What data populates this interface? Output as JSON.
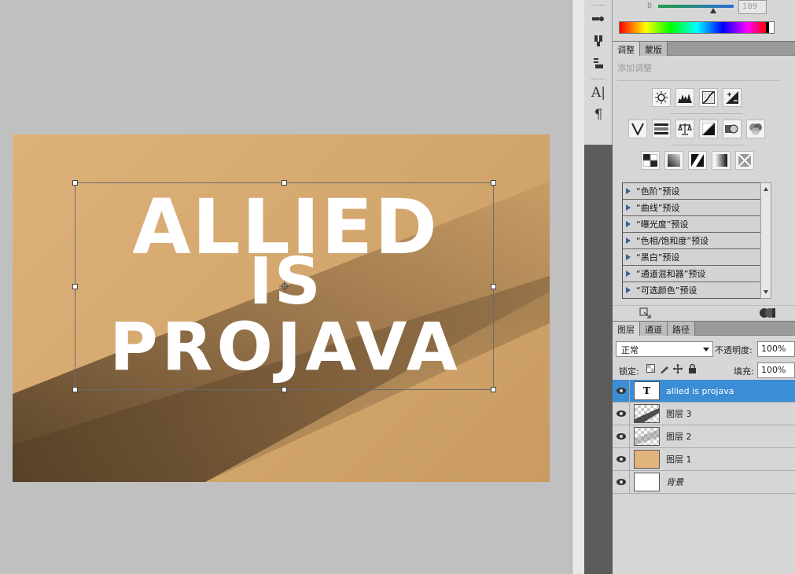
{
  "canvas": {
    "line1": "ALLIED",
    "line2": "IS",
    "line3": "PROJAVA"
  },
  "color_panel": {
    "channel_label": "B",
    "channel_value": "189"
  },
  "adjustments": {
    "tabs": [
      {
        "label": "调整",
        "active": true
      },
      {
        "label": "蒙版",
        "active": false
      }
    ],
    "add_label": "添加调整",
    "presets": [
      {
        "label": "“色阶”预设"
      },
      {
        "label": "“曲线”预设"
      },
      {
        "label": "“曝光度”预设"
      },
      {
        "label": "“色相/饱和度”预设"
      },
      {
        "label": "“黑白”预设"
      },
      {
        "label": "“通道混和器”预设"
      },
      {
        "label": "“可选颜色”预设"
      }
    ]
  },
  "layers": {
    "tabs": [
      {
        "label": "图层",
        "active": true
      },
      {
        "label": "通道",
        "active": false
      },
      {
        "label": "路径",
        "active": false
      }
    ],
    "blend_mode": "正常",
    "opacity_label": "不透明度:",
    "opacity_value": "100%",
    "lock_label": "锁定:",
    "fill_label": "填充:",
    "fill_value": "100%",
    "items": [
      {
        "name": "allied is projava",
        "thumb": "T",
        "selected": true
      },
      {
        "name": "图层 3",
        "selected": false
      },
      {
        "name": "图层 2",
        "selected": false
      },
      {
        "name": "图层 1",
        "selected": false
      },
      {
        "name": "背景",
        "selected": false
      }
    ]
  },
  "colors": {
    "canvas_background": "#d5a970",
    "selection_highlight": "#3b8ed5",
    "panel_background": "#d6d6d6"
  }
}
